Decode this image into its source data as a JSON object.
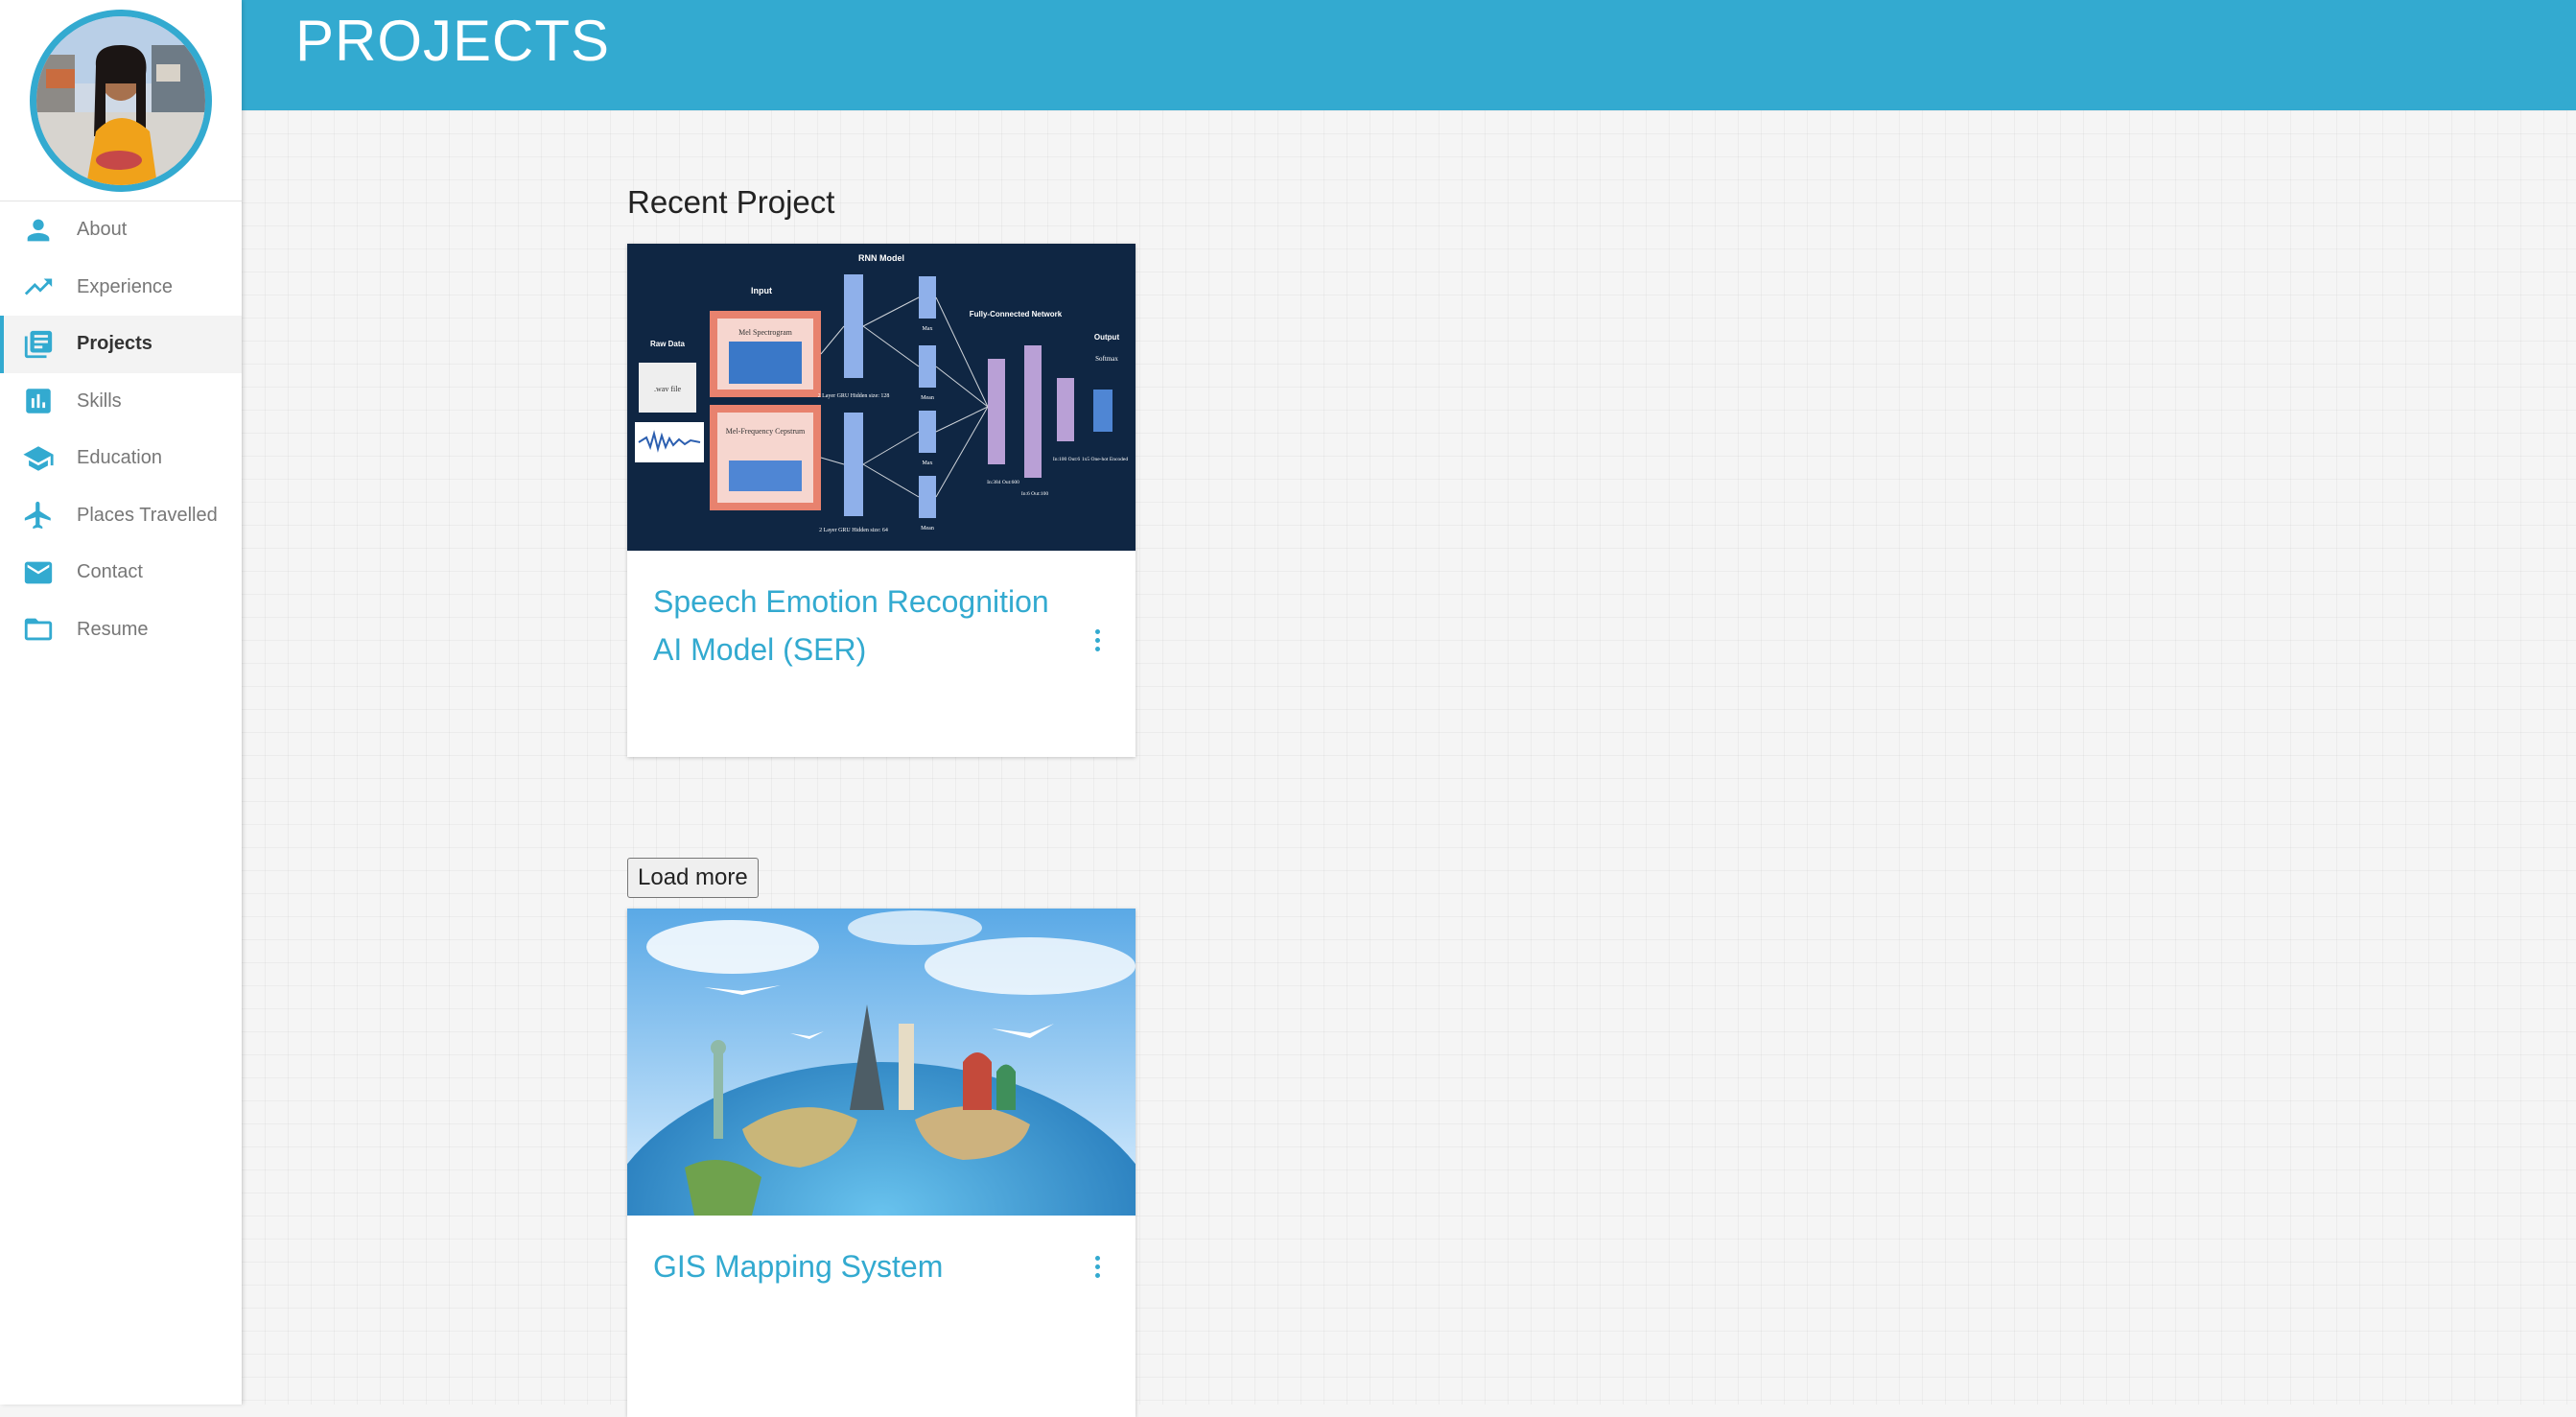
{
  "header": {
    "title": "PROJECTS"
  },
  "sidebar": {
    "items": [
      {
        "label": "About",
        "icon": "person-icon"
      },
      {
        "label": "Experience",
        "icon": "trending-up-icon"
      },
      {
        "label": "Projects",
        "icon": "projects-icon",
        "active": true
      },
      {
        "label": "Skills",
        "icon": "bar-chart-icon"
      },
      {
        "label": "Education",
        "icon": "graduation-cap-icon"
      },
      {
        "label": "Places Travelled",
        "icon": "airplane-icon"
      },
      {
        "label": "Contact",
        "icon": "mail-icon"
      },
      {
        "label": "Resume",
        "icon": "folder-icon"
      }
    ]
  },
  "main": {
    "section_title": "Recent Project",
    "load_more": "Load more",
    "cards": [
      {
        "title": "Speech Emotion Recognition AI Model (SER)",
        "diagram": {
          "heading": "RNN Model",
          "input_label": "Input",
          "raw_data_label": "Raw Data",
          "wav_label": ".wav file",
          "mel_spec": "Mel Spectrogram",
          "mfcc": "Mel-Frequency Cepstrum",
          "gru1": "2 Layer GRU Hidden size: 128",
          "gru2": "2 Layer GRU Hidden size: 64",
          "max": "Max",
          "mean": "Mean",
          "fc": "Fully-Connected Network",
          "output": "Output",
          "softmax": "Softmax",
          "fc1": "In:384 Out:600",
          "fc2": "In:6 Out:100",
          "fc3": "In:100 Out:6",
          "fc4": "1x5 One-hot Encoded"
        }
      },
      {
        "title": "GIS Mapping System"
      }
    ]
  },
  "colors": {
    "accent": "#33aad0",
    "diagram_bg": "#0f2643"
  }
}
